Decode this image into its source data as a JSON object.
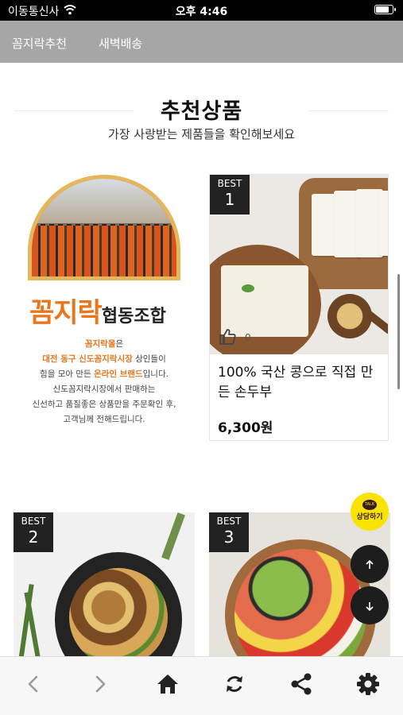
{
  "status_bar": {
    "carrier": "이동통신사",
    "time": "오후 4:46",
    "battery_level": 0.85
  },
  "top_nav": {
    "tabs": [
      {
        "label": "꼼지락추천"
      },
      {
        "label": "새벽배송"
      }
    ]
  },
  "section": {
    "title": "추천상품",
    "subtitle": "가장 사랑받는 제품들을 확인해보세요"
  },
  "promo": {
    "logo": "꼼지락",
    "coop": "협동조합",
    "lines": [
      {
        "hl": "꼼지락몰",
        "text": "은"
      },
      {
        "hl": "대전 동구 신도꼼지락시장",
        "text": " 상인들이"
      },
      {
        "pre": "힘을 모아 만든 ",
        "hl": "온라인 브랜드",
        "text": "입니다."
      },
      {
        "text": "신도꼼지락시장에서 판매하는"
      },
      {
        "text": "신선하고 품질좋은 상품만을 주문확인 후,"
      },
      {
        "text": "고객님께 전해드립니다."
      }
    ]
  },
  "products": [
    {
      "badge_label": "BEST",
      "rank": "1",
      "title": "100% 국산 콩으로 직접 만든 손두부",
      "price": "6,300원",
      "likes": "0",
      "image_icon": "tofu-image"
    },
    {
      "badge_label": "BEST",
      "rank": "2",
      "image_icon": "stir-fry-noodle-image"
    },
    {
      "badge_label": "BEST",
      "rank": "3",
      "image_icon": "poke-salad-image"
    }
  ],
  "floating": {
    "talk_badge": "TALK",
    "talk_label": "상담하기"
  },
  "toolbar": {
    "icons": [
      "back-icon",
      "forward-icon",
      "home-icon",
      "reload-icon",
      "share-icon",
      "settings-icon"
    ]
  }
}
